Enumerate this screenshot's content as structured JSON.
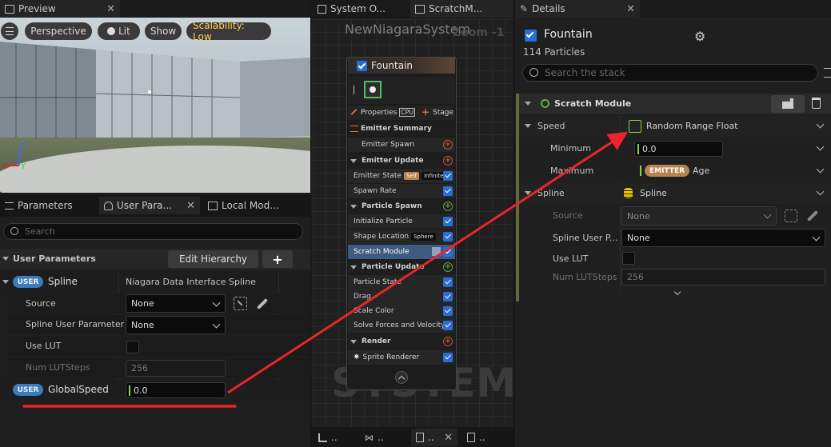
{
  "preview": {
    "tab_title": "Preview",
    "viewport_buttons": {
      "perspective": "Perspective",
      "lit": "Lit",
      "show": "Show",
      "scalability": "Scalability: Low"
    },
    "axis": {
      "z": "Z",
      "x": "X",
      "y": "Y"
    }
  },
  "params_panel": {
    "tabs": [
      {
        "label": "Parameters"
      },
      {
        "label": "User Para..."
      },
      {
        "label": "Local Mod..."
      }
    ],
    "search_placeholder": "Search",
    "section_title": "User Parameters",
    "edit_hierarchy": "Edit Hierarchy",
    "add_symbol": "+",
    "spline": {
      "badge": "USER",
      "name": "Spline",
      "type": "Niagara Data Interface Spline",
      "source_label": "Source",
      "source_value": "None",
      "spline_user_param_label": "Spline User Parameter",
      "spline_user_param_value": "None",
      "use_lut_label": "Use LUT",
      "num_lut_label": "Num LUTSteps",
      "num_lut_value": "256"
    },
    "global_speed": {
      "badge": "USER",
      "name": "GlobalSpeed",
      "value": "0.0"
    }
  },
  "system_overview": {
    "tabs": [
      {
        "label": "System O..."
      },
      {
        "label": "ScratchM..."
      }
    ],
    "system_name": "NewNiagaraSystem",
    "zoom": "Zoom -1",
    "watermark": "SYSTEM",
    "emitter": {
      "title": "Fountain",
      "properties": "Properties",
      "cpu": "CPU",
      "stage": "Stage",
      "rows": [
        {
          "label": "Emitter Summary"
        },
        {
          "label": "Emitter Spawn"
        },
        {
          "label": "Emitter Update"
        },
        {
          "label": "Emitter State",
          "tag1": "Self",
          "tag2": "Infinite"
        },
        {
          "label": "Spawn Rate"
        },
        {
          "label": "Particle Spawn"
        },
        {
          "label": "Initialize Particle"
        },
        {
          "label": "Shape Location",
          "tag1": "Sphere"
        },
        {
          "label": "Scratch Module"
        },
        {
          "label": "Particle Update"
        },
        {
          "label": "Particle State"
        },
        {
          "label": "Drag"
        },
        {
          "label": "Scale Color"
        },
        {
          "label": "Solve Forces and Velocity"
        },
        {
          "label": "Render"
        },
        {
          "label": "Sprite Renderer"
        }
      ]
    },
    "bottom_tabs": [
      {
        "label": ".."
      },
      {
        "label": ".."
      },
      {
        "label": ".."
      },
      {
        "label": ".."
      }
    ]
  },
  "details": {
    "tab_title": "Details",
    "emitter_name": "Fountain",
    "particle_count": "114 Particles",
    "search_placeholder": "Search the stack",
    "module_title": "Scratch Module",
    "speed": {
      "label": "Speed",
      "value": "Random Range Float",
      "min_label": "Minimum",
      "min_value": "0.0",
      "max_label": "Maximum",
      "max_badge": "EMITTER",
      "max_value": "Age"
    },
    "spline": {
      "label": "Spline",
      "value": "Spline",
      "source_label": "Source",
      "source_value": "None",
      "user_param_label": "Spline User P...",
      "user_param_value": "None",
      "use_lut_label": "Use LUT",
      "num_lut_label": "Num LUTSteps",
      "num_lut_value": "256"
    }
  },
  "colors": {
    "annotation_red": "#e8252b",
    "user_badge": "#3c7ab8",
    "emitter_badge": "#b9834f",
    "scalability_text": "#ffd24a",
    "accent_blue": "#2a6dd6"
  }
}
